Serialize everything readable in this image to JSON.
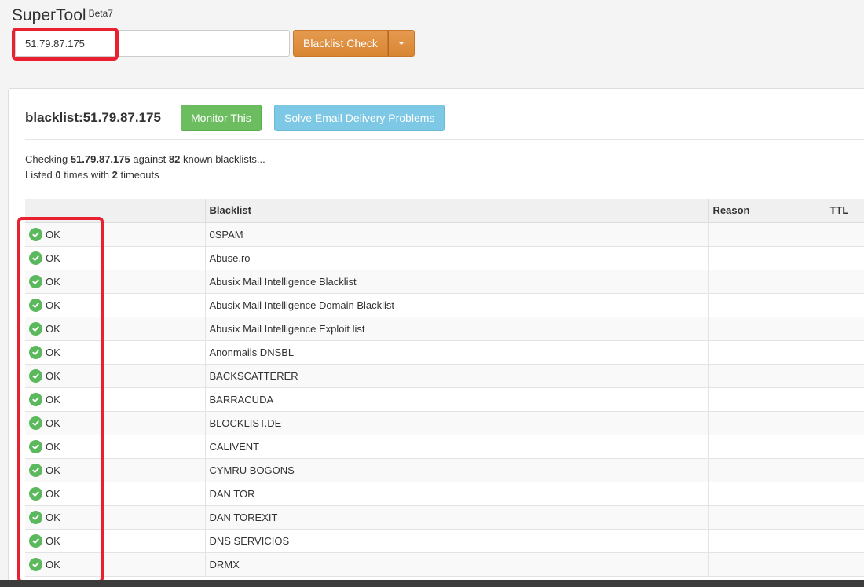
{
  "app": {
    "brand": "SuperTool",
    "beta": "Beta7"
  },
  "search": {
    "value": "51.79.87.175"
  },
  "toolbar": {
    "check_label": "Blacklist Check"
  },
  "result": {
    "title": "blacklist:51.79.87.175",
    "monitor_label": "Monitor This",
    "solve_label": "Solve Email Delivery Problems"
  },
  "summary": {
    "checking_prefix": "Checking",
    "ip": "51.79.87.175",
    "against": "against",
    "count": "82",
    "known": "known blacklists...",
    "listed_prefix": "Listed",
    "listed_count": "0",
    "times_with": "times with",
    "timeouts_count": "2",
    "timeouts_label": "timeouts"
  },
  "table": {
    "headers": [
      "",
      "Blacklist",
      "Reason",
      "TTL"
    ],
    "rows": [
      {
        "status": "OK",
        "blacklist": "0SPAM",
        "reason": "",
        "ttl": ""
      },
      {
        "status": "OK",
        "blacklist": "Abuse.ro",
        "reason": "",
        "ttl": ""
      },
      {
        "status": "OK",
        "blacklist": "Abusix Mail Intelligence Blacklist",
        "reason": "",
        "ttl": ""
      },
      {
        "status": "OK",
        "blacklist": "Abusix Mail Intelligence Domain Blacklist",
        "reason": "",
        "ttl": ""
      },
      {
        "status": "OK",
        "blacklist": "Abusix Mail Intelligence Exploit list",
        "reason": "",
        "ttl": ""
      },
      {
        "status": "OK",
        "blacklist": "Anonmails DNSBL",
        "reason": "",
        "ttl": ""
      },
      {
        "status": "OK",
        "blacklist": "BACKSCATTERER",
        "reason": "",
        "ttl": ""
      },
      {
        "status": "OK",
        "blacklist": "BARRACUDA",
        "reason": "",
        "ttl": ""
      },
      {
        "status": "OK",
        "blacklist": "BLOCKLIST.DE",
        "reason": "",
        "ttl": ""
      },
      {
        "status": "OK",
        "blacklist": "CALIVENT",
        "reason": "",
        "ttl": ""
      },
      {
        "status": "OK",
        "blacklist": "CYMRU BOGONS",
        "reason": "",
        "ttl": ""
      },
      {
        "status": "OK",
        "blacklist": "DAN TOR",
        "reason": "",
        "ttl": ""
      },
      {
        "status": "OK",
        "blacklist": "DAN TOREXIT",
        "reason": "",
        "ttl": ""
      },
      {
        "status": "OK",
        "blacklist": "DNS SERVICIOS",
        "reason": "",
        "ttl": ""
      },
      {
        "status": "OK",
        "blacklist": "DRMX",
        "reason": "",
        "ttl": ""
      }
    ]
  },
  "colors": {
    "accent_orange": "#d98633",
    "monitor_green": "#6cbd5f",
    "solve_blue": "#7dc8e4",
    "ok_green": "#5cb85c",
    "highlight_red": "#e8202f"
  }
}
